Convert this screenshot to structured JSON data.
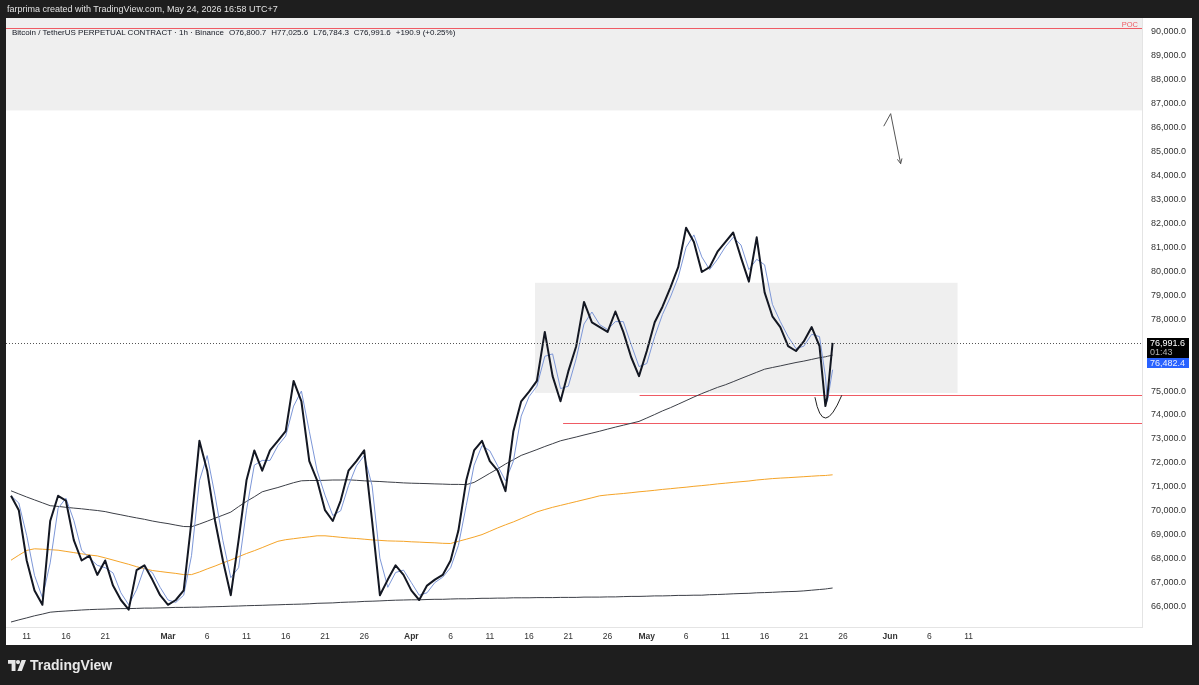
{
  "header": {
    "attribution": "farprima created with TradingView.com, May 24, 2026 16:58 UTC+7"
  },
  "chart": {
    "legend": {
      "symbol": "Bitcoin / TetherUS PERPETUAL CONTRACT · 1h · Binance",
      "values": [
        "O76,800.7",
        "H77,025.6",
        "L76,784.3",
        "C76,991.6",
        "+190.9 (+0.25%)"
      ]
    },
    "price_scale": {
      "last_price": "76,991.6",
      "countdown": "01:43",
      "indicator_value": "76,482.4"
    },
    "chart_data": {
      "type": "line",
      "x": [
        "2026-02-09",
        "2026-02-10",
        "2026-02-11",
        "2026-02-12",
        "2026-02-13",
        "2026-02-14",
        "2026-02-15",
        "2026-02-16",
        "2026-02-17",
        "2026-02-18",
        "2026-02-19",
        "2026-02-20",
        "2026-02-21",
        "2026-02-22",
        "2026-02-23",
        "2026-02-24",
        "2026-02-25",
        "2026-02-26",
        "2026-02-27",
        "2026-02-28",
        "2026-03-01",
        "2026-03-02",
        "2026-03-03",
        "2026-03-04",
        "2026-03-05",
        "2026-03-06",
        "2026-03-07",
        "2026-03-08",
        "2026-03-09",
        "2026-03-10",
        "2026-03-11",
        "2026-03-12",
        "2026-03-13",
        "2026-03-14",
        "2026-03-15",
        "2026-03-16",
        "2026-03-17",
        "2026-03-18",
        "2026-03-19",
        "2026-03-20",
        "2026-03-21",
        "2026-03-22",
        "2026-03-23",
        "2026-03-24",
        "2026-03-25",
        "2026-03-26",
        "2026-03-27",
        "2026-03-28",
        "2026-03-29",
        "2026-03-30",
        "2026-03-31",
        "2026-04-01",
        "2026-04-02",
        "2026-04-03",
        "2026-04-04",
        "2026-04-05",
        "2026-04-06",
        "2026-04-07",
        "2026-04-08",
        "2026-04-09",
        "2026-04-10",
        "2026-04-11",
        "2026-04-12",
        "2026-04-13",
        "2026-04-14",
        "2026-04-15",
        "2026-04-16",
        "2026-04-17",
        "2026-04-18",
        "2026-04-19",
        "2026-04-20",
        "2026-04-21",
        "2026-04-22",
        "2026-04-23",
        "2026-04-24",
        "2026-04-25",
        "2026-04-26",
        "2026-04-27",
        "2026-04-28",
        "2026-04-29",
        "2026-04-30",
        "2026-05-01",
        "2026-05-02",
        "2026-05-03",
        "2026-05-04",
        "2026-05-05",
        "2026-05-06",
        "2026-05-07",
        "2026-05-08",
        "2026-05-09",
        "2026-05-10",
        "2026-05-11",
        "2026-05-12",
        "2026-05-13",
        "2026-05-14",
        "2026-05-15",
        "2026-05-16",
        "2026-05-17",
        "2026-05-18",
        "2026-05-19",
        "2026-05-20",
        "2026-05-21",
        "2026-05-22",
        "2026-05-23",
        "2026-05-23T18:00",
        "2026-05-24",
        "2026-05-24T16:00"
      ],
      "series": [
        {
          "color": "#131722",
          "values": [
            70600,
            70000,
            67900,
            66650,
            66050,
            69550,
            70600,
            70400,
            68750,
            67900,
            68100,
            67300,
            67900,
            66850,
            66250,
            65850,
            67500,
            67700,
            67100,
            66450,
            66050,
            66250,
            66650,
            69550,
            72900,
            71650,
            69550,
            67900,
            66450,
            68750,
            71250,
            72500,
            71650,
            72500,
            72900,
            73300,
            75400,
            74550,
            72050,
            71250,
            70000,
            69550,
            70400,
            71650,
            72050,
            72500,
            69550,
            66450,
            67100,
            67700,
            67300,
            66650,
            66250,
            66850,
            67100,
            67300,
            67900,
            69150,
            71250,
            72500,
            72900,
            72050,
            71650,
            70800,
            73300,
            74550,
            74950,
            75400,
            77450,
            75600,
            74550,
            75800,
            76850,
            78700,
            77850,
            77650,
            77450,
            78300,
            77450,
            76400,
            75600,
            76650,
            77850,
            78500,
            79300,
            80150,
            81800,
            81200,
            79950,
            80150,
            80800,
            81200,
            81600,
            80550,
            79550,
            81400,
            79100,
            78100,
            77650,
            76850,
            76650,
            77050,
            77650,
            76850,
            74350,
            74750,
            76990
          ]
        },
        {
          "color": "#3c3f47",
          "values": [
            70810,
            70680,
            70550,
            70430,
            70310,
            70190,
            70160,
            70120,
            70090,
            70060,
            70020,
            69990,
            69940,
            69870,
            69810,
            69740,
            69680,
            69620,
            69550,
            69490,
            69440,
            69380,
            69320,
            69310,
            69420,
            69540,
            69670,
            69790,
            69920,
            70150,
            70370,
            70560,
            70770,
            70860,
            70950,
            71050,
            71150,
            71230,
            71240,
            71240,
            71250,
            71260,
            71260,
            71270,
            71250,
            71230,
            71210,
            71200,
            71180,
            71160,
            71140,
            71130,
            71120,
            71110,
            71100,
            71090,
            71080,
            71080,
            71070,
            71160,
            71350,
            71540,
            71730,
            71930,
            72110,
            72290,
            72410,
            72530,
            72660,
            72780,
            72900,
            72980,
            73060,
            73140,
            73220,
            73300,
            73390,
            73470,
            73550,
            73630,
            73710,
            73850,
            74000,
            74150,
            74280,
            74430,
            74580,
            74730,
            74870,
            75000,
            75130,
            75240,
            75370,
            75500,
            75630,
            75760,
            75890,
            75960,
            76030,
            76100,
            76170,
            76230,
            76300,
            76370,
            76410,
            76430,
            76480
          ]
        },
        {
          "color": "#f5a428",
          "values": [
            67910,
            68120,
            68320,
            68390,
            68370,
            68350,
            68330,
            68280,
            68230,
            68180,
            68130,
            68090,
            68010,
            67920,
            67830,
            67740,
            67640,
            67560,
            67480,
            67440,
            67400,
            67360,
            67310,
            67310,
            67420,
            67550,
            67670,
            67800,
            67920,
            68060,
            68190,
            68310,
            68440,
            68570,
            68700,
            68770,
            68810,
            68850,
            68890,
            68930,
            68930,
            68900,
            68870,
            68840,
            68820,
            68790,
            68760,
            68740,
            68720,
            68710,
            68700,
            68680,
            68670,
            68650,
            68640,
            68620,
            68610,
            68700,
            68790,
            68880,
            68980,
            69120,
            69260,
            69390,
            69510,
            69650,
            69790,
            69930,
            70030,
            70120,
            70200,
            70280,
            70360,
            70440,
            70520,
            70600,
            70640,
            70670,
            70700,
            70730,
            70770,
            70800,
            70830,
            70870,
            70900,
            70930,
            70960,
            71000,
            71030,
            71060,
            71100,
            71130,
            71160,
            71190,
            71220,
            71260,
            71290,
            71320,
            71340,
            71360,
            71380,
            71400,
            71420,
            71440,
            71450,
            71460,
            71480
          ]
        },
        {
          "color": "#3c3f47",
          "values": [
            65330,
            65420,
            65500,
            65590,
            65660,
            65740,
            65770,
            65790,
            65810,
            65830,
            65850,
            65860,
            65870,
            65880,
            65890,
            65890,
            65900,
            65910,
            65910,
            65920,
            65930,
            65940,
            65940,
            65950,
            65950,
            65960,
            65970,
            65980,
            65990,
            66000,
            66010,
            66020,
            66030,
            66040,
            66050,
            66060,
            66070,
            66080,
            66090,
            66110,
            66120,
            66130,
            66150,
            66160,
            66170,
            66190,
            66200,
            66210,
            66230,
            66240,
            66250,
            66260,
            66260,
            66270,
            66280,
            66280,
            66290,
            66300,
            66300,
            66310,
            66320,
            66320,
            66330,
            66330,
            66340,
            66340,
            66340,
            66350,
            66350,
            66350,
            66360,
            66360,
            66360,
            66370,
            66370,
            66370,
            66380,
            66380,
            66390,
            66400,
            66400,
            66410,
            66420,
            66420,
            66430,
            66440,
            66440,
            66450,
            66450,
            66470,
            66480,
            66490,
            66510,
            66520,
            66530,
            66550,
            66560,
            66570,
            66590,
            66600,
            66610,
            66630,
            66660,
            66690,
            66710,
            66720,
            66750
          ]
        },
        {
          "color": "#7d97d8",
          "values": [
            70600,
            70300,
            68950,
            67280,
            66350,
            67800,
            70080,
            70500,
            69580,
            68330,
            68000,
            67700,
            67600,
            67380,
            66550,
            66050,
            66680,
            67600,
            67400,
            66780,
            66250,
            66150,
            66450,
            68100,
            71230,
            72280,
            70600,
            68730,
            67180,
            67600,
            70000,
            71880,
            72080,
            72080,
            72700,
            73100,
            74350,
            74980,
            73300,
            71650,
            70630,
            69780,
            69980,
            71030,
            71850,
            72280,
            71030,
            68000,
            66780,
            67400,
            67500,
            66980,
            66450,
            66550,
            66980,
            67200,
            67600,
            68530,
            70200,
            71880,
            72700,
            72480,
            71850,
            71230,
            72050,
            73930,
            74750,
            75180,
            76430,
            76530,
            75080,
            75180,
            76330,
            77780,
            78280,
            77750,
            77550,
            77880,
            77880,
            76930,
            76000,
            76130,
            77250,
            78180,
            78900,
            79730,
            80980,
            81500,
            80580,
            80050,
            80480,
            81000,
            81400,
            81080,
            80050,
            80480,
            80250,
            78600,
            77880,
            77250,
            76750,
            76850,
            77350,
            77250,
            75600,
            74550,
            75870
          ]
        }
      ],
      "xlim": [
        "2026-02-08T08:48",
        "2026-07-03T05:00"
      ],
      "ylim": [
        65080,
        90560
      ],
      "xticks": [
        {
          "value": "2026-02-11",
          "label": "11"
        },
        {
          "value": "2026-02-16",
          "label": "16"
        },
        {
          "value": "2026-02-21",
          "label": "21"
        },
        {
          "value": "2026-03-01",
          "label": "Mar"
        },
        {
          "value": "2026-03-06",
          "label": "6"
        },
        {
          "value": "2026-03-11",
          "label": "11"
        },
        {
          "value": "2026-03-16",
          "label": "16"
        },
        {
          "value": "2026-03-21",
          "label": "21"
        },
        {
          "value": "2026-03-26",
          "label": "26"
        },
        {
          "value": "2026-04-01",
          "label": "Apr"
        },
        {
          "value": "2026-04-06",
          "label": "6"
        },
        {
          "value": "2026-04-11",
          "label": "11"
        },
        {
          "value": "2026-04-16",
          "label": "16"
        },
        {
          "value": "2026-04-21",
          "label": "21"
        },
        {
          "value": "2026-04-26",
          "label": "26"
        },
        {
          "value": "2026-05-01",
          "label": "May"
        },
        {
          "value": "2026-05-06",
          "label": "6"
        },
        {
          "value": "2026-05-11",
          "label": "11"
        },
        {
          "value": "2026-05-16",
          "label": "16"
        },
        {
          "value": "2026-05-21",
          "label": "21"
        },
        {
          "value": "2026-05-26",
          "label": "26"
        },
        {
          "value": "2026-06-01",
          "label": "Jun"
        },
        {
          "value": "2026-06-06",
          "label": "6"
        },
        {
          "value": "2026-06-11",
          "label": "11"
        }
      ],
      "yticks": [
        {
          "value": 66000,
          "label": "66,000.0"
        },
        {
          "value": 67000,
          "label": "67,000.0"
        },
        {
          "value": 68000,
          "label": "68,000.0"
        },
        {
          "value": 69000,
          "label": "69,000.0"
        },
        {
          "value": 70000,
          "label": "70,000.0"
        },
        {
          "value": 71000,
          "label": "71,000.0"
        },
        {
          "value": 72000,
          "label": "72,000.0"
        },
        {
          "value": 73000,
          "label": "73,000.0"
        },
        {
          "value": 74000,
          "label": "74,000.0"
        },
        {
          "value": 75000,
          "label": "75,000.0"
        },
        {
          "value": 78000,
          "label": "78,000.0"
        },
        {
          "value": 79000,
          "label": "79,000.0"
        },
        {
          "value": 80000,
          "label": "80,000.0"
        },
        {
          "value": 81000,
          "label": "81,000.0"
        },
        {
          "value": 82000,
          "label": "82,000.0"
        },
        {
          "value": 83000,
          "label": "83,000.0"
        },
        {
          "value": 84000,
          "label": "84,000.0"
        },
        {
          "value": 85000,
          "label": "85,000.0"
        },
        {
          "value": 86000,
          "label": "86,000.0"
        },
        {
          "value": 87000,
          "label": "87,000.0"
        },
        {
          "value": 88000,
          "label": "88,000.0"
        },
        {
          "value": 89000,
          "label": "89,000.0"
        },
        {
          "value": 90000,
          "label": "90,000.0"
        }
      ],
      "bands": [
        {
          "axis": "y",
          "from": 86700,
          "to": 90560
        },
        {
          "axis": "y",
          "from": 74900,
          "to": 79500
        }
      ],
      "ref_lines": [
        {
          "axis": "y",
          "value": 90150,
          "label": "POC",
          "color": "#ef5b64"
        },
        {
          "axis": "y",
          "value": 74800,
          "color": "#ef5b64"
        },
        {
          "axis": "y",
          "value": 73650,
          "color": "#ef5b64"
        },
        {
          "axis": "y",
          "value": 76990,
          "color": "#555555"
        }
      ]
    }
  },
  "footer": {
    "brand": "TradingView"
  }
}
